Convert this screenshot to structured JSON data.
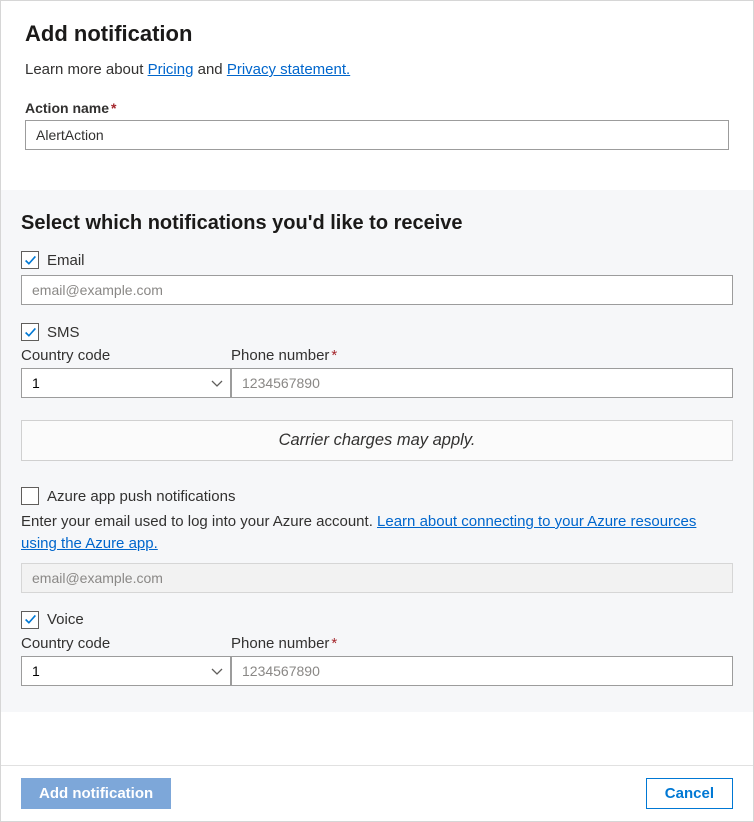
{
  "header": {
    "title": "Add notification",
    "intro_prefix": "Learn more about ",
    "link_pricing": "Pricing",
    "intro_and": " and ",
    "link_privacy": " Privacy statement."
  },
  "action_name": {
    "label": "Action name",
    "value": "AlertAction"
  },
  "section": {
    "title": "Select which notifications you'd like to receive",
    "email": {
      "label": "Email",
      "checked": true,
      "placeholder": "email@example.com",
      "value": ""
    },
    "sms": {
      "label": "SMS",
      "checked": true,
      "cc_label": "Country code",
      "cc_value": "1",
      "phone_label": "Phone number",
      "phone_placeholder": "1234567890",
      "phone_value": ""
    },
    "carrier_notice": "Carrier charges may apply.",
    "azure_push": {
      "label": "Azure app push notifications",
      "checked": false,
      "helper_prefix": "Enter your email used to log into your Azure account.  ",
      "helper_link": "Learn about connecting to your Azure resources using the Azure app.",
      "placeholder": "email@example.com"
    },
    "voice": {
      "label": "Voice",
      "checked": true,
      "cc_label": "Country code",
      "cc_value": "1",
      "phone_label": "Phone number",
      "phone_placeholder": "1234567890",
      "phone_value": ""
    }
  },
  "footer": {
    "primary": "Add notification",
    "secondary": "Cancel"
  }
}
